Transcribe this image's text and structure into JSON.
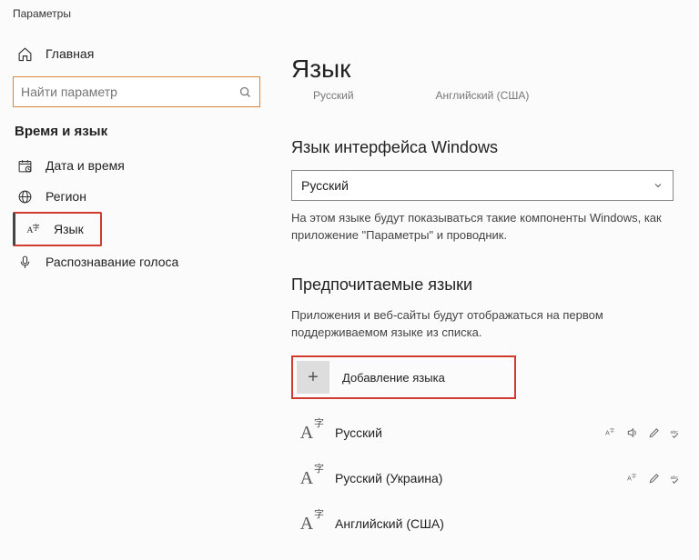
{
  "window": {
    "title": "Параметры"
  },
  "sidebar": {
    "home": "Главная",
    "search_placeholder": "Найти параметр",
    "section": "Время и язык",
    "items": [
      {
        "label": "Дата и время"
      },
      {
        "label": "Регион"
      },
      {
        "label": "Язык"
      },
      {
        "label": "Распознавание голоса"
      }
    ]
  },
  "main": {
    "title": "Язык",
    "sub_lang_1": "Русский",
    "sub_lang_2": "Английский (США)",
    "display_lang": {
      "heading": "Язык интерфейса Windows",
      "selected": "Русский",
      "hint": "На этом языке будут показываться такие компоненты Windows, как приложение \"Параметры\" и проводник."
    },
    "preferred": {
      "heading": "Предпочитаемые языки",
      "hint": "Приложения и веб-сайты будут отображаться на первом поддерживаемом языке из списка.",
      "add_label": "Добавление языка",
      "langs": [
        {
          "name": "Русский"
        },
        {
          "name": "Русский (Украина)"
        },
        {
          "name": "Английский (США)"
        }
      ]
    }
  }
}
